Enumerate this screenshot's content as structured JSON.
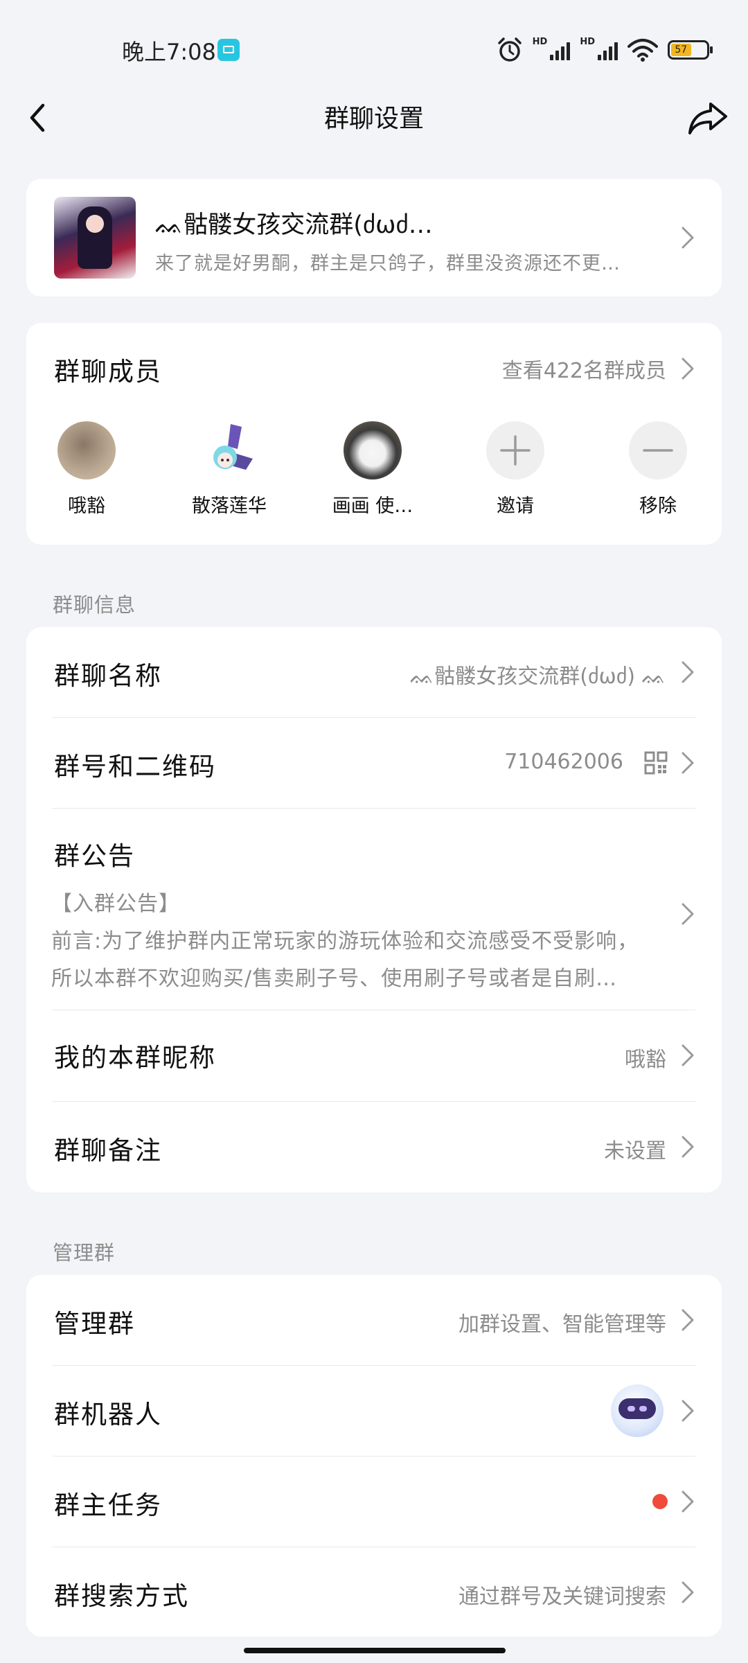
{
  "status_bar": {
    "time": "晚上7:08",
    "hd1": "HD",
    "hd2": "HD",
    "battery": "57"
  },
  "nav": {
    "title": "群聊设置"
  },
  "group": {
    "name": "ᨐ骷髅女孩交流群(ძωძ…",
    "description": "来了就是好男酮，群主是只鸽子，群里没资源还不更…"
  },
  "members": {
    "label": "群聊成员",
    "view_all": "查看422名群成员",
    "list": [
      {
        "name": "哦豁"
      },
      {
        "name": "散落莲华"
      },
      {
        "name": "画画 使…"
      }
    ],
    "invite_label": "邀请",
    "remove_label": "移除"
  },
  "info_section": {
    "title": "群聊信息",
    "name_label": "群聊名称",
    "name_value": "ᨐ骷髅女孩交流群(ძωძ) ᨐ",
    "number_label": "群号和二维码",
    "number_value": "710462006",
    "notice_label": "群公告",
    "notice_line1": "【入群公告】",
    "notice_line2": "前言:为了维护群内正常玩家的游玩体验和交流感受不受影响，",
    "notice_line3": "所以本群不欢迎购买/售卖刷子号、使用刷子号或者是自刷…",
    "nickname_label": "我的本群昵称",
    "nickname_value": "哦豁",
    "remark_label": "群聊备注",
    "remark_value": "未设置"
  },
  "manage_section": {
    "title": "管理群",
    "manage_label": "管理群",
    "manage_value": "加群设置、智能管理等",
    "robot_label": "群机器人",
    "owner_task_label": "群主任务",
    "search_label": "群搜索方式",
    "search_value": "通过群号及关键词搜索"
  }
}
